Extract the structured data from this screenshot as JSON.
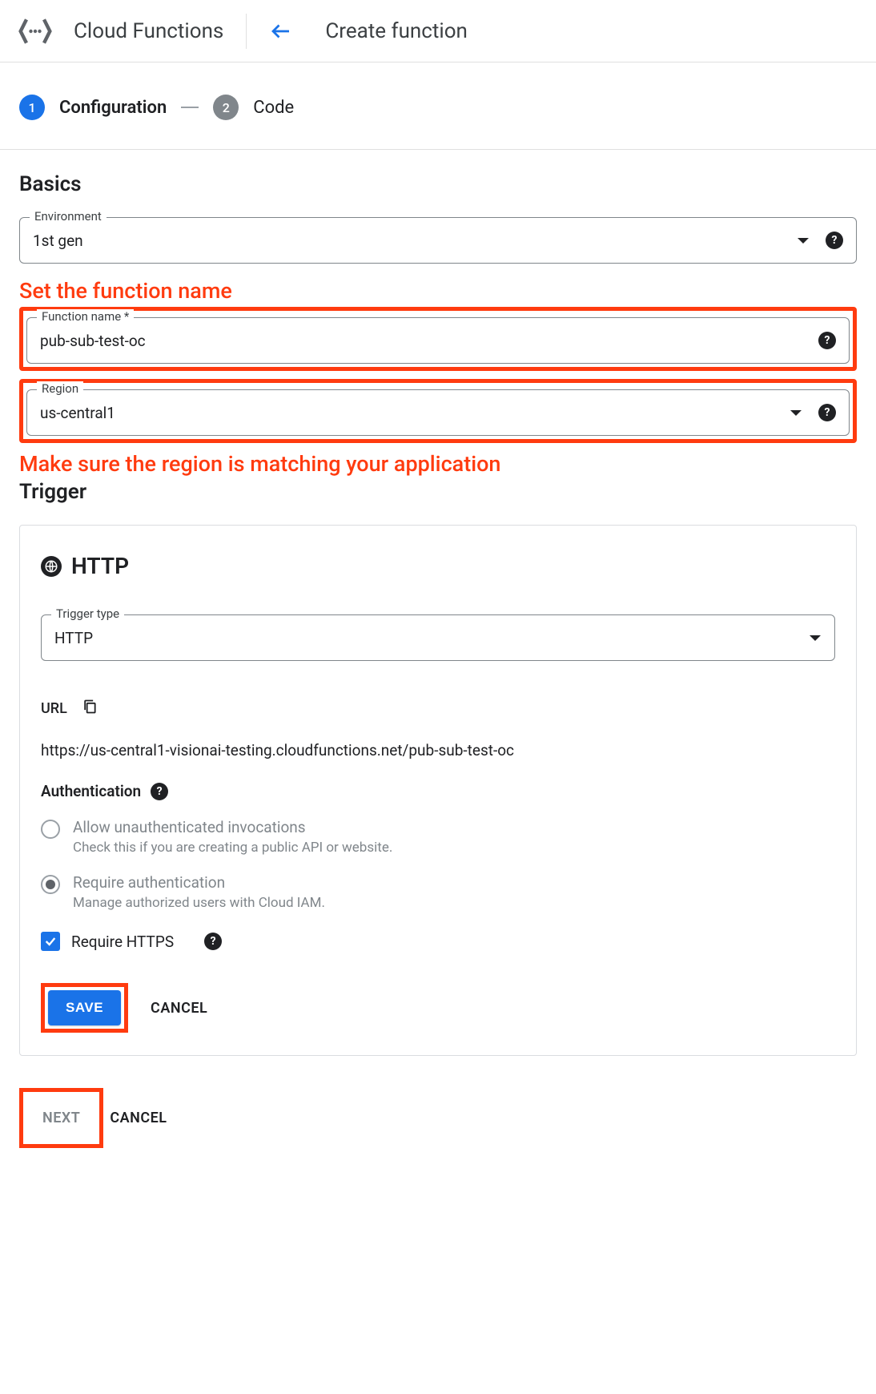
{
  "header": {
    "product": "Cloud Functions",
    "page": "Create function"
  },
  "stepper": {
    "step1_num": "1",
    "step1_label": "Configuration",
    "step2_num": "2",
    "step2_label": "Code"
  },
  "basics": {
    "title": "Basics",
    "environment_label": "Environment",
    "environment_value": "1st gen",
    "function_name_label": "Function name *",
    "function_name_value": "pub-sub-test-oc",
    "region_label": "Region",
    "region_value": "us-central1"
  },
  "annotations": {
    "fn_name": "Set the function name",
    "region": "Make sure the region is matching your application"
  },
  "trigger": {
    "section_title": "Trigger",
    "type_title": "HTTP",
    "trigger_type_label": "Trigger type",
    "trigger_type_value": "HTTP",
    "url_label": "URL",
    "url_value": "https://us-central1-visionai-testing.cloudfunctions.net/pub-sub-test-oc",
    "auth_title": "Authentication",
    "radio_unauth_label": "Allow unauthenticated invocations",
    "radio_unauth_desc": "Check this if you are creating a public API or website.",
    "radio_auth_label": "Require authentication",
    "radio_auth_desc": "Manage authorized users with Cloud IAM.",
    "require_https_label": "Require HTTPS",
    "save_label": "SAVE",
    "cancel_label": "CANCEL"
  },
  "footer": {
    "next_label": "NEXT",
    "cancel_label": "CANCEL"
  }
}
